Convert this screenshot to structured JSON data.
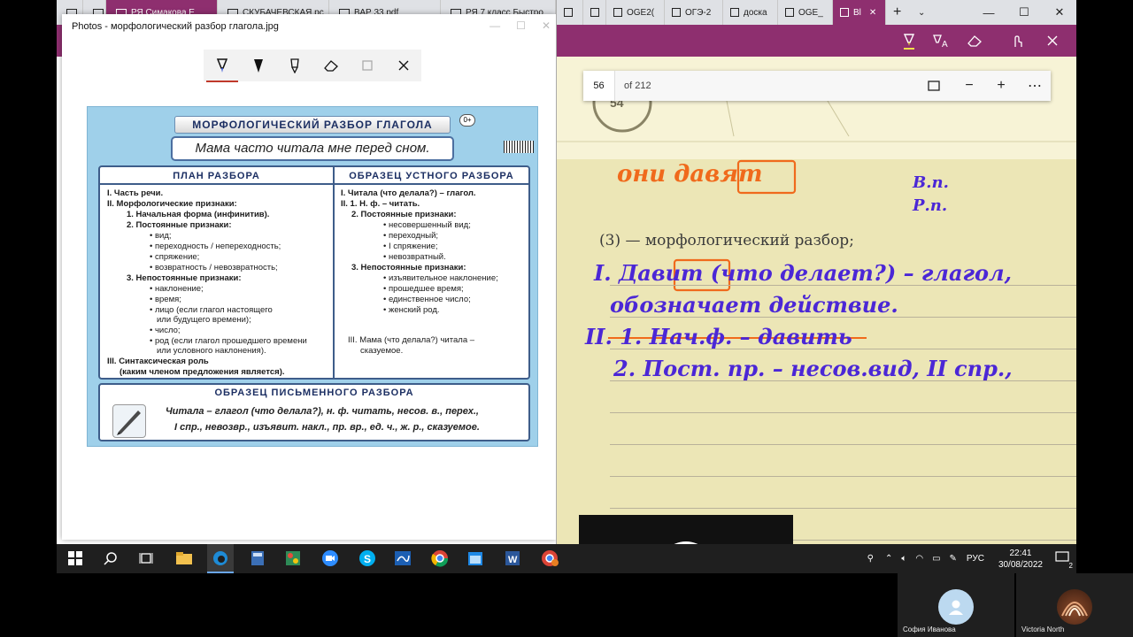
{
  "left_browser": {
    "tabs": [
      {
        "label": ""
      },
      {
        "label": "РЯ Симакова Е"
      },
      {
        "label": "СКУБАЧЕВСКАЯ.рс"
      },
      {
        "label": "ВАР 33.pdf"
      },
      {
        "label": "РЯ 7 класс Быстро"
      }
    ]
  },
  "photos": {
    "window_title": "Photos - морфологический разбор глагола.jpg",
    "toolbar_icons": [
      "ballpoint-pen-icon",
      "calligraphy-pen-icon",
      "pencil-icon",
      "eraser-icon",
      "crop-icon",
      "close-icon"
    ]
  },
  "poster": {
    "title": "МОРФОЛОГИЧЕСКИЙ РАЗБОР ГЛАГОЛА",
    "age": "0+",
    "sentence": "Мама часто читала мне перед сном.",
    "plan_head": "ПЛАН РАЗБОРА",
    "plan_lines": [
      "I. Часть речи.",
      "II. Морфологические признаки:",
      "1. Начальная форма (инфинитив).",
      "2. Постоянные признаки:",
      "• вид;",
      "• переходность / непереходность;",
      "• спряжение;",
      "• возвратность / невозвратность;",
      "3. Непостоянные признаки:",
      "• наклонение;",
      "• время;",
      "• лицо (если глагол настоящего",
      "или будущего времени);",
      "• число;",
      "• род (если глагол прошедшего времени",
      "или условного наклонения).",
      "III. Синтаксическая роль",
      "(каким членом предложения является)."
    ],
    "oral_head": "ОБРАЗЕЦ УСТНОГО РАЗБОРА",
    "oral_lines": [
      "I. Читала (что делала?) – глагол.",
      "II. 1. Н. ф. – читать.",
      "2. Постоянные признаки:",
      "• несовершенный вид;",
      "• переходный;",
      "• I спряжение;",
      "• невозвратный.",
      "3. Непостоянные признаки:",
      "• изъявительное наклонение;",
      "• прошедшее время;",
      "• единственное число;",
      "• женский род.",
      "III. Мама (что делала?) читала –",
      "сказуемое."
    ],
    "written_head": "ОБРАЗЕЦ ПИСЬМЕННОГО РАЗБОРА",
    "written_lines": [
      "Читала – глагол (что делала?), н. ф. читать, несов. в., перех.,",
      "I спр., невозвр., изъявит. накл., пр. вр., ед. ч., ж. р., сказуемое."
    ]
  },
  "right_browser": {
    "tabs": [
      {
        "label": ""
      },
      {
        "label": ""
      },
      {
        "label": "OGE2("
      },
      {
        "label": "ОГЭ-2"
      },
      {
        "label": "доска"
      },
      {
        "label": "OGE_"
      },
      {
        "label": "Вl"
      }
    ],
    "pen_tools": [
      "highlighter-icon",
      "text-highlight-icon",
      "eraser-icon",
      "touch-icon",
      "close-icon"
    ]
  },
  "pdf": {
    "page_current": "56",
    "page_total": "of 212",
    "page_badge": "54",
    "heading": "(3) — морфологический разбор;",
    "ink": {
      "orange": "они давят",
      "blue_cases": [
        "В.п.",
        "Р.п."
      ],
      "line1": "I. Давит (что делает?) – глагол,",
      "line2": "обозначает действие.",
      "line3": "II. 1. Нач.ф. – давить",
      "line4": "2. Пост. пр. – несов.вид, II спр.,"
    }
  },
  "taskbar": {
    "icons": [
      "windows-start-icon",
      "search-icon",
      "task-view-icon",
      "file-explorer-icon",
      "edge-icon",
      "calculator-icon",
      "paint-icon",
      "zoom-icon",
      "skype-icon",
      "whiteboard-icon",
      "chrome-icon",
      "calendar-icon",
      "word-icon",
      "chrome-profile-icon"
    ],
    "language": "РУС",
    "time": "22:41",
    "date": "30/08/2022",
    "notifications": "2"
  },
  "participants": [
    {
      "name": "София Иванова"
    },
    {
      "name": "Victoria North"
    }
  ],
  "colors": {
    "edge_accent": "#8e2f6f",
    "ink_blue": "#4b27d6",
    "ink_orange": "#f06a1c",
    "poster_blue": "#9fd0ea"
  }
}
